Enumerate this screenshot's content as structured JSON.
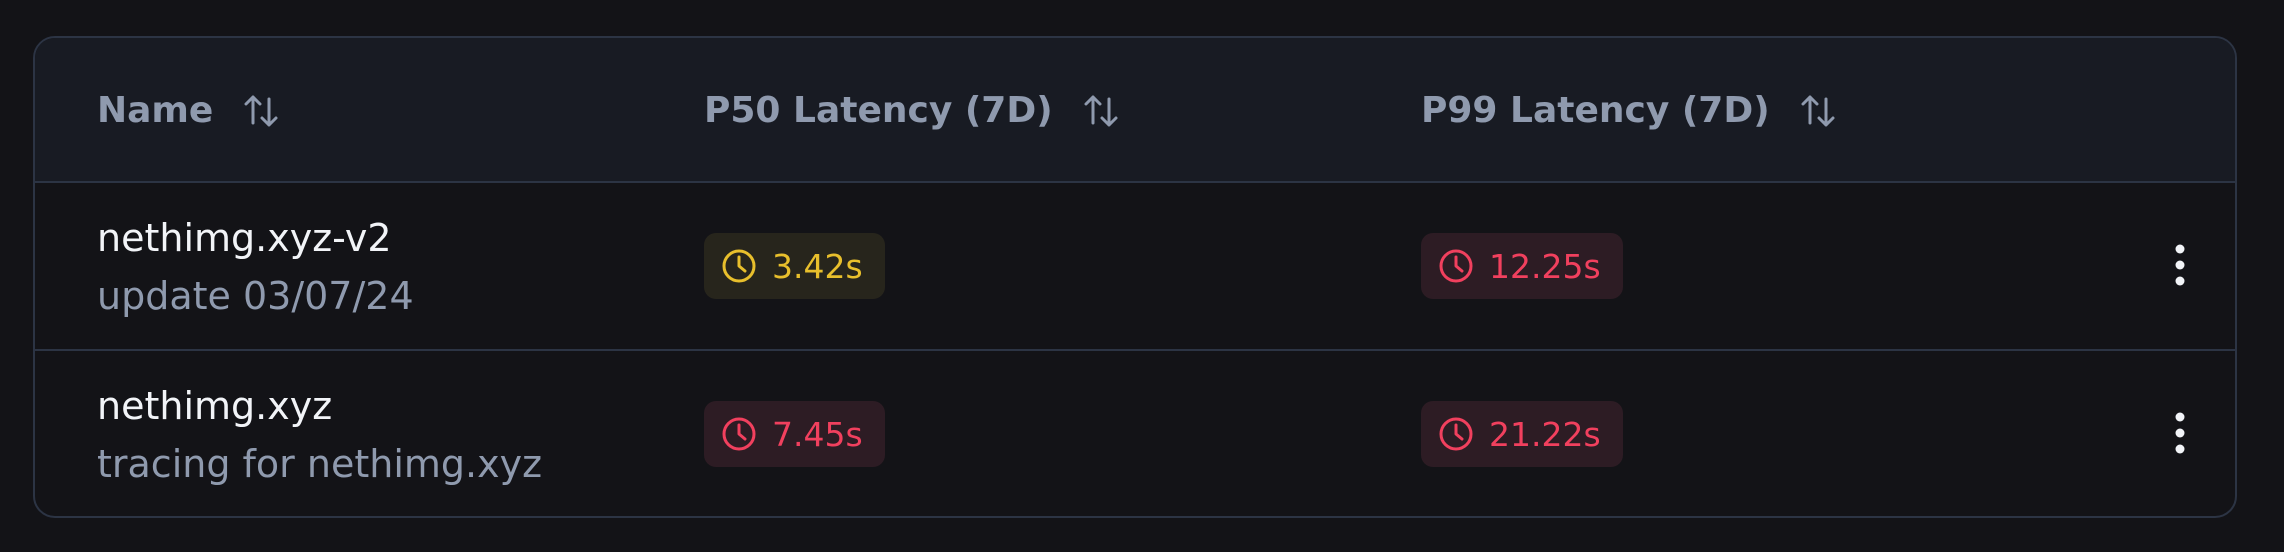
{
  "table": {
    "columns": [
      {
        "label": "Name"
      },
      {
        "label": "P50 Latency (7D)"
      },
      {
        "label": "P99 Latency (7D)"
      }
    ],
    "rows": [
      {
        "name": "nethimg.xyz-v2",
        "description": "update 03/07/24",
        "p50": {
          "value": "3.42s",
          "status": "warning"
        },
        "p99": {
          "value": "12.25s",
          "status": "critical"
        }
      },
      {
        "name": "nethimg.xyz",
        "description": "tracing for nethimg.xyz",
        "p50": {
          "value": "7.45s",
          "status": "critical"
        },
        "p99": {
          "value": "21.22s",
          "status": "critical"
        }
      }
    ]
  },
  "icons": {
    "sort": "sort-arrows-icon",
    "clock": "clock-icon",
    "menu": "more-vertical-icon"
  },
  "colors": {
    "background": "#131317",
    "header_background": "#181b23",
    "border": "#2c3444",
    "warning": "#e8bf2c",
    "critical": "#f1405e",
    "muted_text": "#8f9aae",
    "primary_text": "#f2f4f8"
  }
}
